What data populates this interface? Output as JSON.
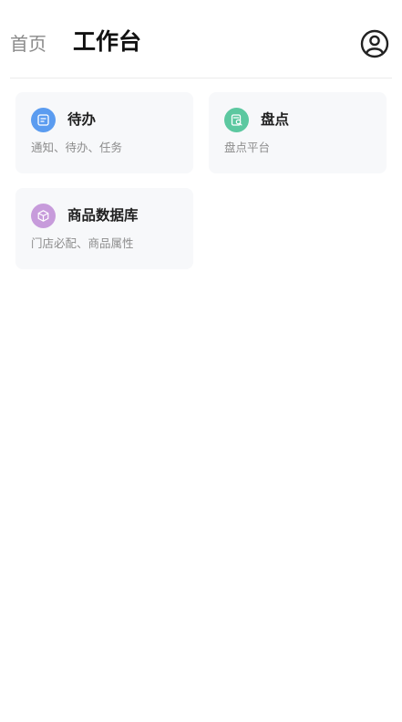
{
  "header": {
    "tabs": [
      {
        "label": "首页",
        "active": false
      },
      {
        "label": "工作台",
        "active": true
      }
    ],
    "profile_icon": "user-circle-icon"
  },
  "cards": [
    {
      "title": "待办",
      "description": "通知、待办、任务",
      "icon": "todo-icon",
      "icon_color": "#5b9cf0"
    },
    {
      "title": "盘点",
      "description": "盘点平台",
      "icon": "inventory-icon",
      "icon_color": "#5cc8a0"
    },
    {
      "title": "商品数据库",
      "description": "门店必配、商品属性",
      "icon": "cube-icon",
      "icon_color": "#c79bdb"
    }
  ],
  "colors": {
    "active_tab": "#111111",
    "inactive_tab": "#8a8a8a",
    "card_background": "#f7f8fa"
  }
}
